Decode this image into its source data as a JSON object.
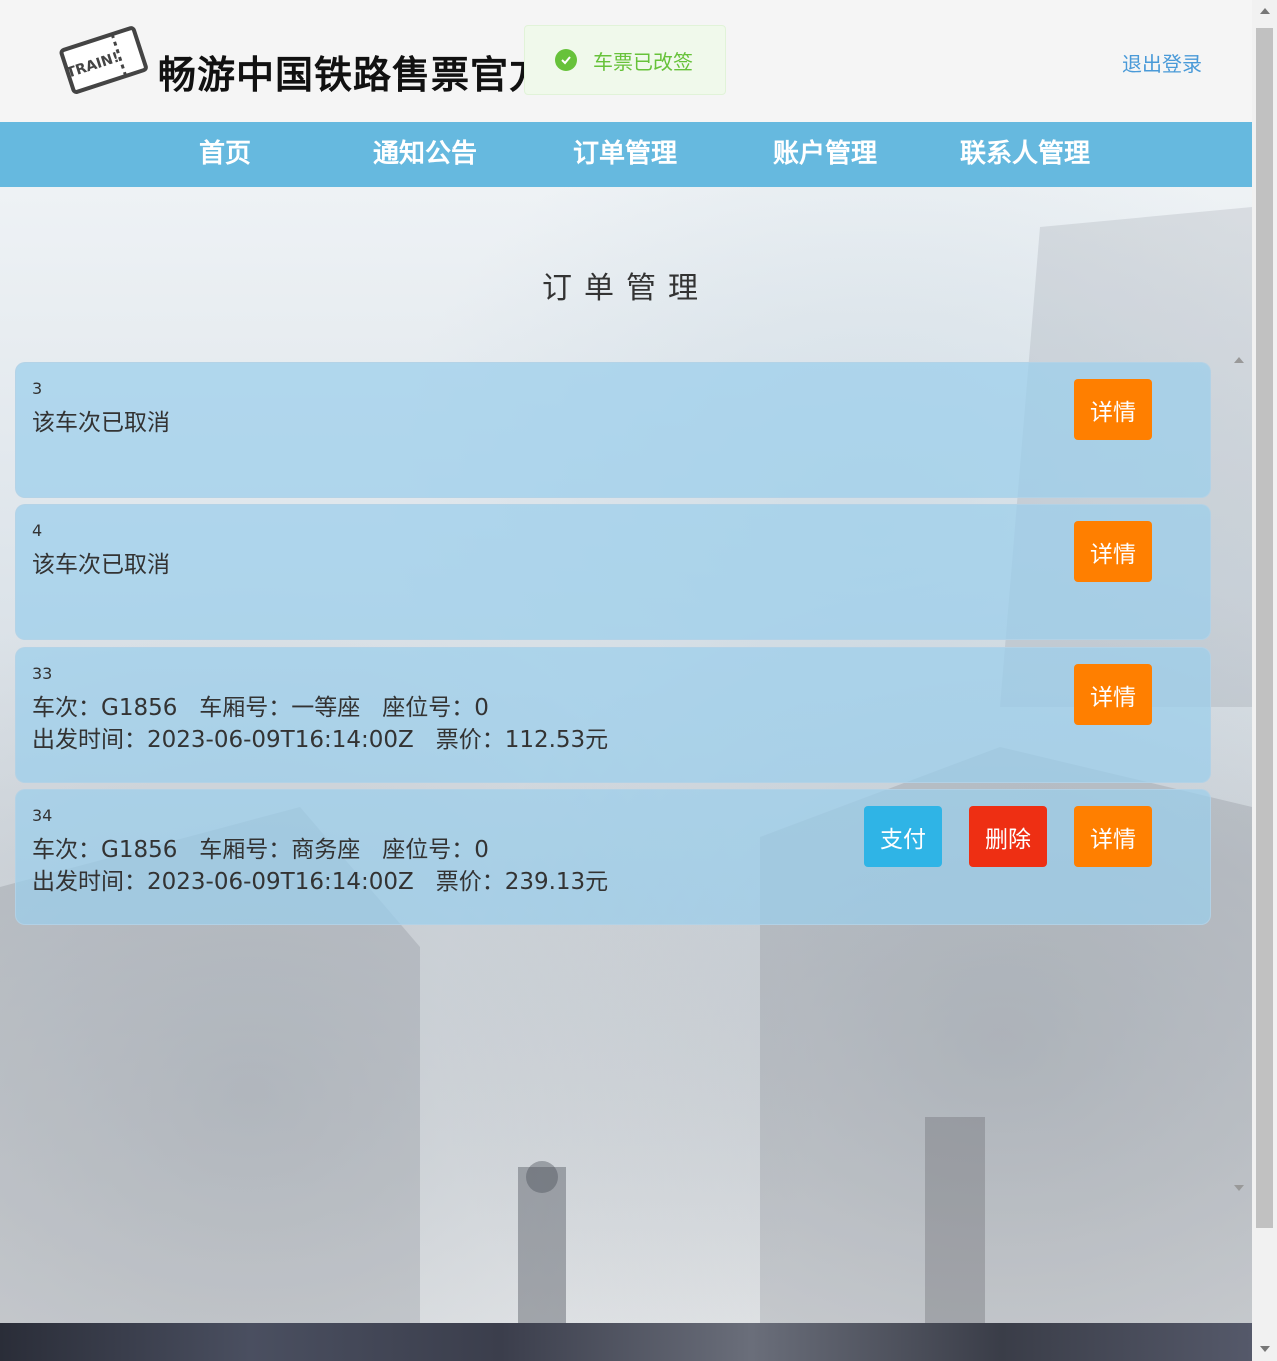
{
  "header": {
    "site_title": "畅游中国铁路售票官方",
    "logout_label": "退出登录",
    "logo_text": "TRAIN!"
  },
  "toast": {
    "message": "车票已改签"
  },
  "nav": {
    "items": [
      {
        "label": "首页"
      },
      {
        "label": "通知公告"
      },
      {
        "label": "订单管理"
      },
      {
        "label": "账户管理"
      },
      {
        "label": "联系人管理"
      }
    ]
  },
  "main": {
    "title": "订单管理",
    "orders": [
      {
        "id": "3",
        "line1": "该车次已取消",
        "line2": "",
        "detail_label": "详情"
      },
      {
        "id": "4",
        "line1": "该车次已取消",
        "line2": "",
        "detail_label": "详情"
      },
      {
        "id": "33",
        "line1": "车次：G1856   车厢号：一等座   座位号：0",
        "line2": "出发时间：2023-06-09T16:14:00Z   票价：112.53元",
        "detail_label": "详情"
      },
      {
        "id": "34",
        "line1": "车次：G1856   车厢号：商务座   座位号：0",
        "line2": "出发时间：2023-06-09T16:14:00Z   票价：239.13元",
        "pay_label": "支付",
        "delete_label": "删除",
        "detail_label": "详情"
      }
    ]
  },
  "colors": {
    "nav_bg": "#66b9df",
    "detail_button": "#ff7f00",
    "delete_button": "#ee2f13",
    "pay_button": "#2fb4e6",
    "success": "#67c23a"
  }
}
